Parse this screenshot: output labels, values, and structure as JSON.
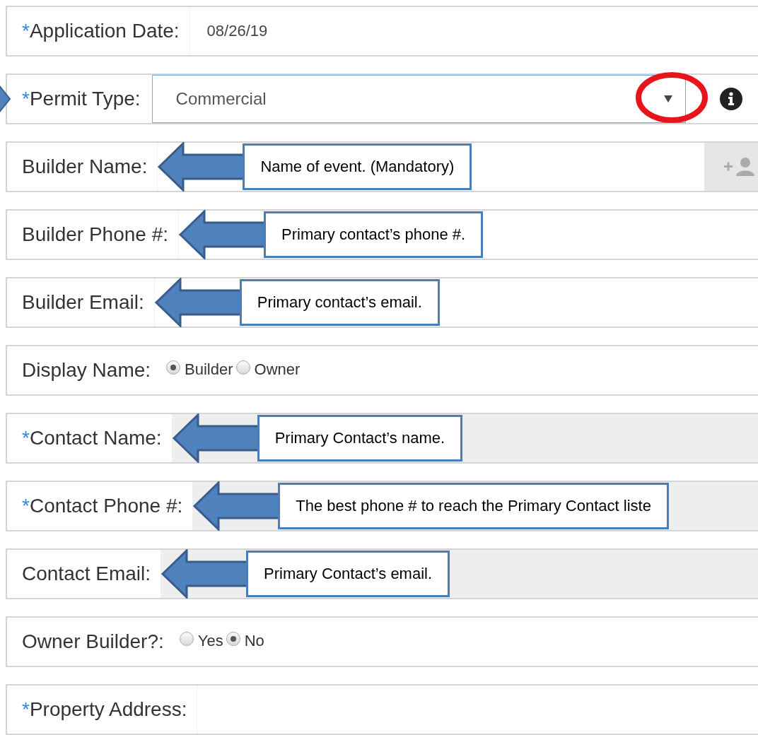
{
  "rows": [
    {
      "kind": "text",
      "mark": "*",
      "label": "Application Date:",
      "value": "08/26/19",
      "disabled": false
    },
    {
      "kind": "select",
      "mark": "*",
      "label": "Permit Type:",
      "value": "Commercial",
      "pointer_arrow": true,
      "caret_circled": true,
      "info": true
    },
    {
      "kind": "text_button",
      "label": "Builder Name:",
      "disabled": false,
      "callout": "Name of event. (Mandatory)"
    },
    {
      "kind": "text",
      "label": "Builder Phone #:",
      "disabled": false,
      "callout": "Primary contact’s phone #."
    },
    {
      "kind": "text",
      "label": "Builder Email:",
      "disabled": false,
      "callout": "Primary contact’s email."
    },
    {
      "kind": "radio",
      "label": "Display Name:",
      "options": [
        {
          "label": "Builder",
          "selected": true
        },
        {
          "label": "Owner",
          "selected": false
        }
      ]
    },
    {
      "kind": "text",
      "mark": "*",
      "label": "Contact Name:",
      "disabled": true,
      "callout": "Primary Contact’s name."
    },
    {
      "kind": "text",
      "mark": "*",
      "label": "Contact Phone #:",
      "disabled": true,
      "callout": "The best phone # to reach the Primary Contact liste"
    },
    {
      "kind": "text",
      "label": "Contact Email:",
      "disabled": true,
      "callout": "Primary Contact’s email."
    },
    {
      "kind": "radio",
      "label": "Owner Builder?:",
      "options": [
        {
          "label": "Yes",
          "selected": false
        },
        {
          "label": "No",
          "selected": true
        }
      ]
    },
    {
      "kind": "text",
      "mark": "*",
      "label": "Property Address:",
      "disabled": false
    }
  ]
}
